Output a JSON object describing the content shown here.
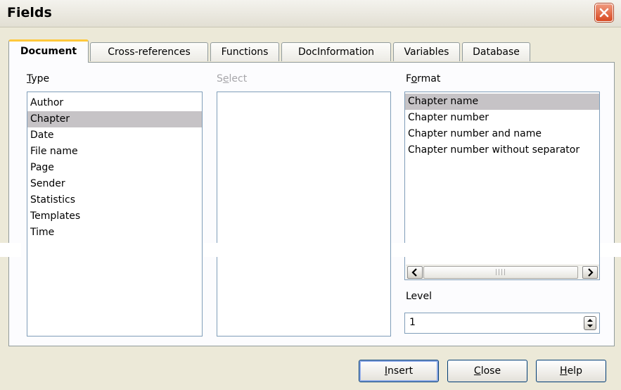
{
  "window": {
    "title": "Fields"
  },
  "tabs": [
    {
      "label": "Document",
      "active": true
    },
    {
      "label": "Cross-references",
      "active": false
    },
    {
      "label": "Functions",
      "active": false
    },
    {
      "label": "DocInformation",
      "active": false
    },
    {
      "label": "Variables",
      "active": false
    },
    {
      "label": "Database",
      "active": false
    }
  ],
  "type": {
    "label_mnemonic": "T",
    "label_rest": "ype",
    "items": [
      "Author",
      "Chapter",
      "Date",
      "File name",
      "Page",
      "Sender",
      "Statistics",
      "Templates",
      "Time"
    ],
    "selected": "Chapter"
  },
  "select": {
    "label_first": "S",
    "label_mnemonic": "e",
    "label_rest": "lect"
  },
  "format": {
    "label_first": "F",
    "label_mnemonic": "o",
    "label_rest": "rmat",
    "items": [
      "Chapter name",
      "Chapter number",
      "Chapter number and name",
      "Chapter number without separator"
    ],
    "selected": "Chapter name"
  },
  "level": {
    "label": "Level",
    "value": "1"
  },
  "buttons": {
    "insert_mnemonic": "I",
    "insert_rest": "nsert",
    "close_mnemonic": "C",
    "close_rest": "lose",
    "help_mnemonic": "H",
    "help_rest": "elp"
  },
  "icons": {
    "close": "close-icon",
    "scroll_left": "chevron-left-icon",
    "scroll_right": "chevron-right-icon",
    "spinner": "spin-updown-icon"
  },
  "colors": {
    "selection": "#c6c3c6",
    "tab_highlight": "#ffc83c",
    "close_button": "#d84a23"
  }
}
